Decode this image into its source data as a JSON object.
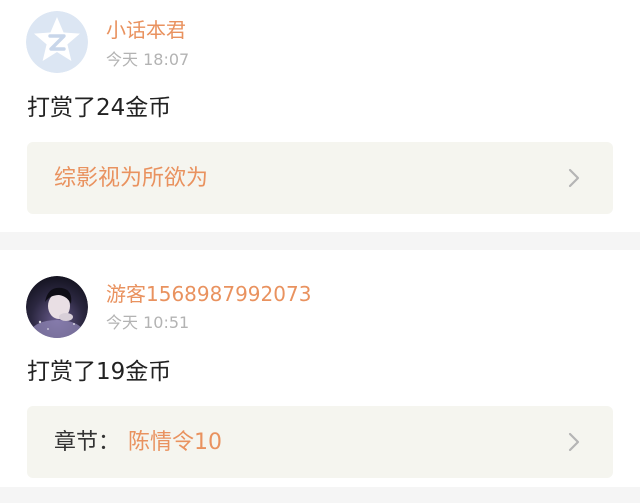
{
  "entries": [
    {
      "user": "小话本君",
      "time": "今天 18:07",
      "reward": "打赏了24金币",
      "book_label": "",
      "book_title": "综影视为所欲为",
      "avatar_icon": "qq-star-icon"
    },
    {
      "user": "游客1568987992073",
      "time": "今天 10:51",
      "reward": "打赏了19金币",
      "book_label": "章节：",
      "book_title": "陈情令10",
      "avatar_icon": "user-photo-avatar"
    }
  ],
  "colors": {
    "accent": "#e9925f",
    "timestamp": "#b3b3b3",
    "box_background": "#f5f5ef",
    "divider": "#f5f5f5"
  }
}
